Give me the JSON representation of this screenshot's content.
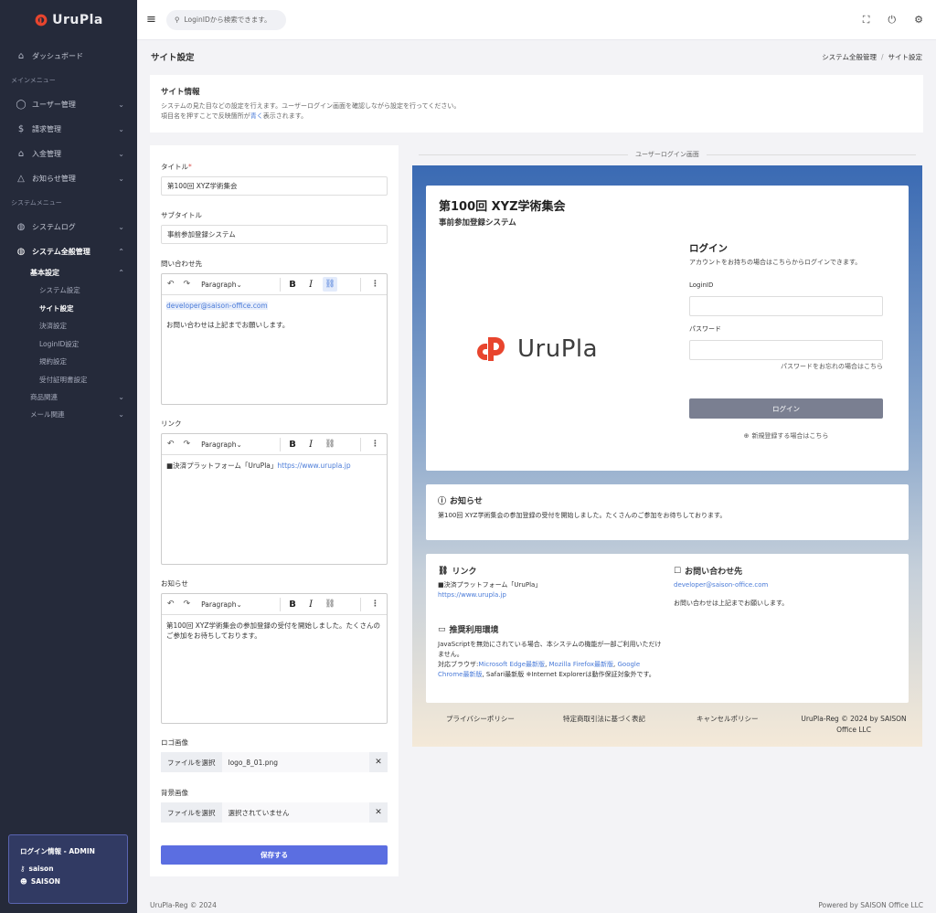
{
  "brand": {
    "name": "UruPla",
    "color": "#e8452e"
  },
  "sidebar": {
    "dashboard": "ダッシュボード",
    "section_main": "メインメニュー",
    "users": "ユーザー管理",
    "billing": "請求管理",
    "payments": "入金管理",
    "notices": "お知らせ管理",
    "section_system": "システムメニュー",
    "syslog": "システムログ",
    "sysadmin": "システム全般管理",
    "basic": "基本設定",
    "basic_items": [
      "システム設定",
      "サイト設定",
      "決済設定",
      "LoginID設定",
      "規約設定",
      "受付証明書設定"
    ],
    "products": "商品関連",
    "mail": "メール関連"
  },
  "login_info": {
    "title": "ログイン情報 - ADMIN",
    "id": "saison",
    "name": "SAISON"
  },
  "topbar": {
    "search_placeholder": "LoginIDから検索できます。"
  },
  "page": {
    "title": "サイト設定",
    "crumb_parent": "システム全般管理",
    "crumb_current": "サイト設定"
  },
  "info": {
    "title": "サイト情報",
    "line1": "システムの見た目などの設定を行えます。ユーザーログイン画面を確認しながら設定を行ってください。",
    "line2_pre": "項目名を押すことで反映箇所が",
    "line2_blue": "青く",
    "line2_post": "表示されます。"
  },
  "form": {
    "title_label": "タイトル",
    "title_required": "*",
    "title_value": "第100回 XYZ学術集会",
    "subtitle_label": "サブタイトル",
    "subtitle_value": "事前参加登録システム",
    "contact_label": "問い合わせ先",
    "paragraph": "Paragraph",
    "contact_email": "developer@saison-office.com",
    "contact_text": "お問い合わせは上記までお願いします。",
    "link_label": "リンク",
    "link_text": "■決済プラットフォーム「UruPla」",
    "link_url": "https://www.urupla.jp",
    "notice_label": "お知らせ",
    "notice_text": "第100回 XYZ学術集会の参加登録の受付を開始しました。たくさんのご参加をお待ちしております。",
    "logo_label": "ロゴ画像",
    "file_button": "ファイルを選択",
    "logo_file": "logo_8_01.png",
    "bg_label": "背景画像",
    "bg_file": "選択されていません",
    "save": "保存する"
  },
  "preview": {
    "label": "ユーザーログイン画面",
    "title": "第100回 XYZ学術集会",
    "subtitle": "事前参加登録システム",
    "logo_text": "UruPla",
    "login_heading": "ログイン",
    "login_desc": "アカウントをお持ちの場合はこちらからログインできます。",
    "loginid_label": "LoginID",
    "password_label": "パスワード",
    "forgot": "パスワードをお忘れの場合はこちら",
    "login_button": "ログイン",
    "register": "新規登録する場合はこちら",
    "notice_heading": "お知らせ",
    "notice_text": "第100回 XYZ学術集会の参加登録の受付を開始しました。たくさんのご参加をお待ちしております。",
    "link_heading": "リンク",
    "link_text": "■決済プラットフォーム「UruPla」",
    "link_url": "https://www.urupla.jp",
    "contact_heading": "お問い合わせ先",
    "contact_email": "developer@saison-office.com",
    "contact_text": "お問い合わせは上記までお願いします。",
    "env_heading": "推奨利用環境",
    "env_line1": "JavaScriptを無効にされている場合、本システムの機能が一部ご利用いただけません。",
    "env_line2_pre": "対応ブラウザ:",
    "env_edge": "Microsoft Edge最新版",
    "env_comma1": ", ",
    "env_firefox": "Mozilla Firefox最新版",
    "env_comma2": ", ",
    "env_chrome": "Google Chrome最新版",
    "env_line2_post": ", Safari最新版 ※Internet Explorerは動作保証対象外です。",
    "footer_privacy": "プライバシーポリシー",
    "footer_tokutei": "特定商取引法に基づく表記",
    "footer_cancel": "キャンセルポリシー",
    "footer_copy1": "UruPla-Reg © 2024 by SAISON",
    "footer_copy2": "Office LLC"
  },
  "footer": {
    "left": "UruPla-Reg © 2024",
    "right": "Powered by SAISON Office LLC"
  }
}
